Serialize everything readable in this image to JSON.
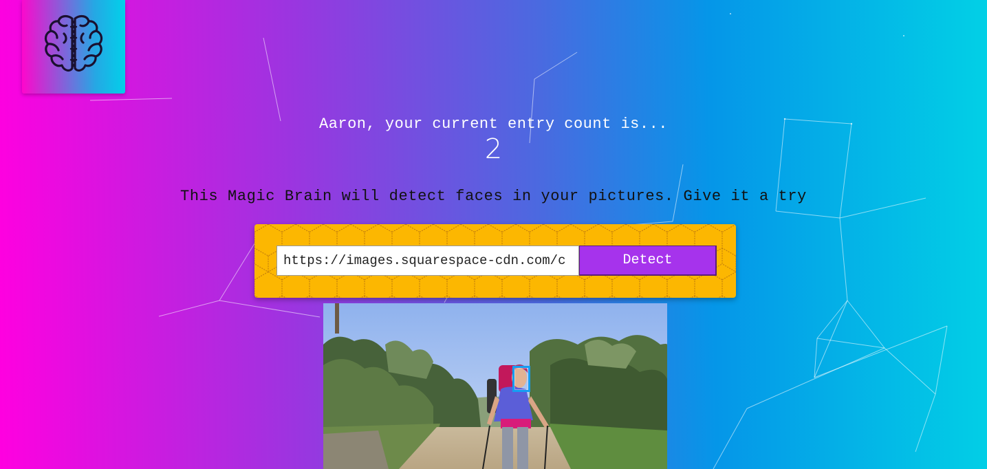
{
  "logo": {
    "icon": "brain-icon"
  },
  "rank": {
    "text": "Aaron, your current entry count is...",
    "count": "2"
  },
  "intro": {
    "text": "This Magic Brain will detect faces in your pictures. Give it a try"
  },
  "form": {
    "url_value": "https://images.squarespace-cdn.com/c",
    "button_label": "Detect",
    "panel_color": "#fcb701",
    "button_color": "#a633ec"
  },
  "result": {
    "image": "hiker-photo",
    "face_box_color": "#149df2"
  }
}
